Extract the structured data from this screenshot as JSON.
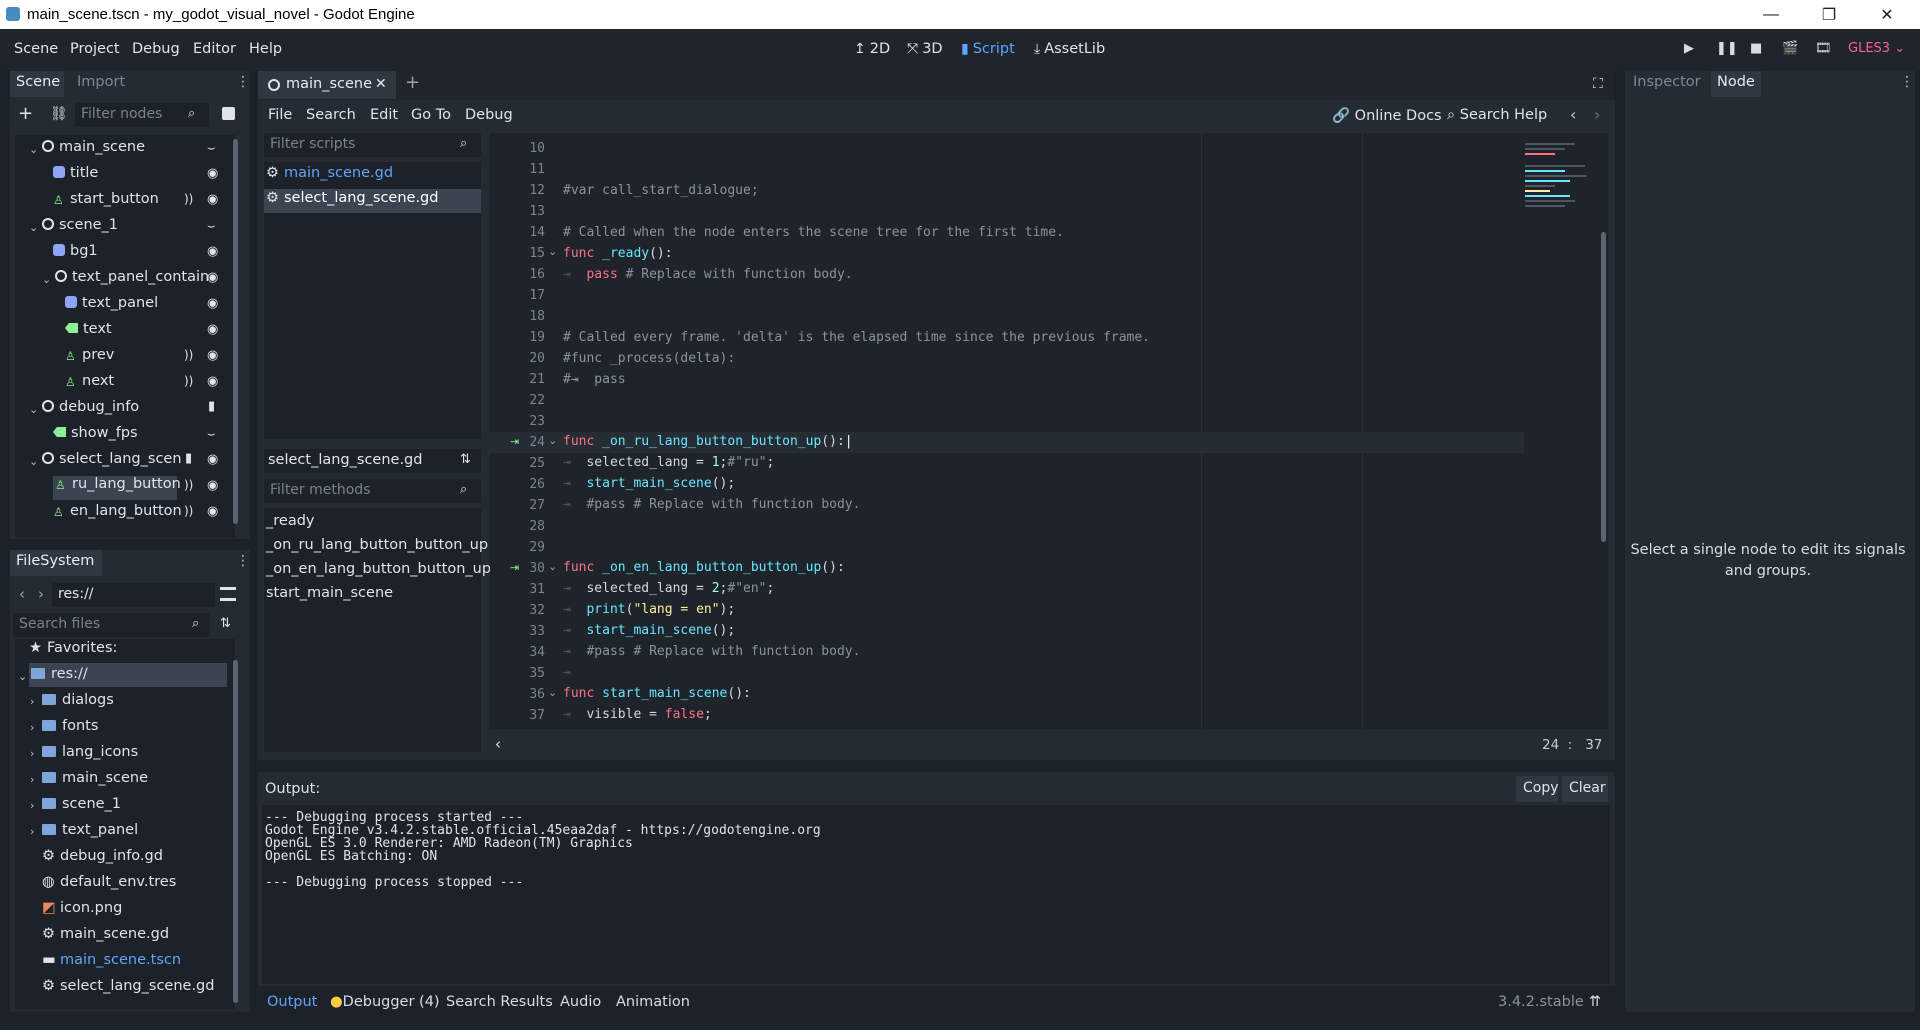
{
  "window": {
    "title": "main_scene.tscn - my_godot_visual_novel - Godot Engine",
    "minimize": "—",
    "maximize": "❐",
    "close": "✕"
  },
  "menu": [
    "Scene",
    "Project",
    "Debug",
    "Editor",
    "Help"
  ],
  "workspaces": {
    "w2d": "2D",
    "w3d": "3D",
    "script": "Script",
    "assetlib": "AssetLib",
    "active": "Script"
  },
  "renderer": "GLES3",
  "scene_dock": {
    "tabs": [
      "Scene",
      "Import"
    ],
    "filter_placeholder": "Filter nodes",
    "nodes": [
      {
        "label": "main_scene"
      },
      {
        "label": "title"
      },
      {
        "label": "start_button"
      },
      {
        "label": "scene_1"
      },
      {
        "label": "bg1"
      },
      {
        "label": "text_panel_contain"
      },
      {
        "label": "text_panel"
      },
      {
        "label": "text"
      },
      {
        "label": "prev"
      },
      {
        "label": "next"
      },
      {
        "label": "debug_info"
      },
      {
        "label": "show_fps"
      },
      {
        "label": "select_lang_scen"
      },
      {
        "label": "ru_lang_button"
      },
      {
        "label": "en_lang_button"
      }
    ],
    "selected": "ru_lang_button"
  },
  "filesystem": {
    "tab": "FileSystem",
    "path": "res://",
    "search_placeholder": "Search files",
    "favorites": "Favorites:",
    "items": [
      {
        "label": "res://"
      },
      {
        "label": "dialogs"
      },
      {
        "label": "fonts"
      },
      {
        "label": "lang_icons"
      },
      {
        "label": "main_scene"
      },
      {
        "label": "scene_1"
      },
      {
        "label": "text_panel"
      },
      {
        "label": "debug_info.gd"
      },
      {
        "label": "default_env.tres"
      },
      {
        "label": "icon.png"
      },
      {
        "label": "main_scene.gd"
      },
      {
        "label": "main_scene.tscn"
      },
      {
        "label": "select_lang_scene.gd"
      }
    ]
  },
  "editor": {
    "scene_tab": "main_scene",
    "script_menu": [
      "File",
      "Search",
      "Edit",
      "Go To",
      "Debug"
    ],
    "online_docs": "Online Docs",
    "search_help": "Search Help",
    "filter_scripts_placeholder": "Filter scripts",
    "scripts": [
      "main_scene.gd",
      "select_lang_scene.gd"
    ],
    "current_script": "select_lang_scene.gd",
    "filter_methods_placeholder": "Filter methods",
    "methods": [
      "_ready",
      "_on_ru_lang_button_button_up",
      "_on_en_lang_button_button_up",
      "start_main_scene"
    ],
    "line_numbers": [
      "10",
      "11",
      "12",
      "13",
      "14",
      "15",
      "16",
      "17",
      "18",
      "19",
      "20",
      "21",
      "22",
      "23",
      "24",
      "25",
      "26",
      "27",
      "28",
      "29",
      "30",
      "31",
      "32",
      "33",
      "34",
      "35",
      "36",
      "37"
    ],
    "cursor_line": "24",
    "cursor_sep": ":",
    "cursor_col": "37"
  },
  "output": {
    "label": "Output:",
    "copy": "Copy",
    "clear": "Clear",
    "text": "--- Debugging process started ---\nGodot Engine v3.4.2.stable.official.45eaa2daf - https://godotengine.org\nOpenGL ES 3.0 Renderer: AMD Radeon(TM) Graphics\nOpenGL ES Batching: ON\n\n--- Debugging process stopped ---"
  },
  "bottom_tabs": [
    "Output",
    "Debugger (4)",
    "Search Results",
    "Audio",
    "Animation"
  ],
  "version": "3.4.2.stable",
  "inspector": {
    "tabs": [
      "Inspector",
      "Node"
    ],
    "message": "Select a single node to edit its signals and groups."
  },
  "colors": {
    "accent": "#5fa4ff",
    "keyword": "#ff7085",
    "function": "#66e6ff",
    "comment": "#8a939e",
    "renderer": "#ff5f9a"
  }
}
